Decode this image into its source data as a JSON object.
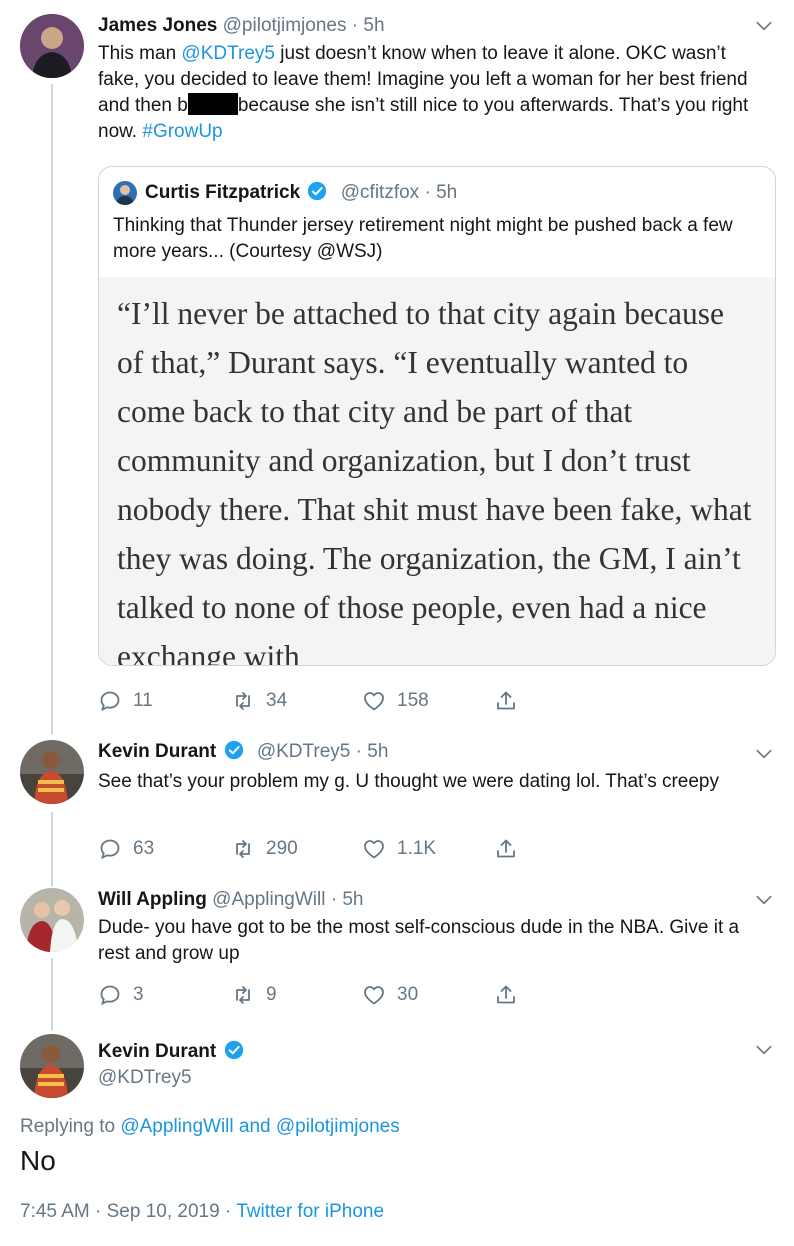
{
  "tweets": [
    {
      "name": "James Jones",
      "handle": "@pilotjimjones",
      "time": "5h",
      "text_pre": "This man ",
      "mention": "@KDTrey5",
      "text_mid": " just doesn’t know when to leave it alone. OKC wasn’t fake, you decided to leave them! Imagine you left a woman for her best friend and then b",
      "text_post": "because she isn’t still nice to you afterwards. That’s you right now. ",
      "hashtag": "#GrowUp",
      "replies": "11",
      "retweets": "34",
      "likes": "158"
    },
    {
      "name": "Kevin Durant",
      "handle": "@KDTrey5",
      "time": "5h",
      "text": "See that’s your problem my g. U thought we were dating lol. That’s creepy",
      "replies": "63",
      "retweets": "290",
      "likes": "1.1K"
    },
    {
      "name": "Will Appling",
      "handle": "@ApplingWill",
      "time": "5h",
      "text": "Dude- you have got to be the most self-conscious dude in the NBA. Give it a rest and grow up",
      "replies": "3",
      "retweets": "9",
      "likes": "30"
    }
  ],
  "quote": {
    "name": "Curtis Fitzpatrick",
    "handle": "@cfitzfox",
    "time": "5h",
    "text": "Thinking that Thunder jersey retirement night might be pushed back a few more years... (Courtesy @WSJ)",
    "image_text": "“I’ll never be attached to that city again because of that,” Durant says. “I eventually wanted to come back to that city and be part of that community and organization, but I don’t trust nobody there. That shit must have been fake, what they was doing. The organization, the GM, I ain’t talked to none of those people, even had a nice exchange with"
  },
  "main_tweet": {
    "name": "Kevin Durant",
    "handle": "@KDTrey5",
    "replying_label": "Replying to ",
    "reply_user1": "@ApplingWill",
    "reply_and": " and ",
    "reply_user2": "@pilotjimjones",
    "text": "No",
    "time": "7:45 AM",
    "date": "Sep 10, 2019",
    "source": "Twitter for iPhone"
  },
  "symbols": {
    "dot": "·"
  },
  "colors": {
    "link": "#1b95e0",
    "muted": "#657786",
    "verified": "#1da1f2",
    "border": "#ccd6dd"
  },
  "icons": [
    "chevron-down-icon",
    "verified-badge-icon",
    "reply-icon",
    "retweet-icon",
    "like-icon",
    "share-icon"
  ]
}
